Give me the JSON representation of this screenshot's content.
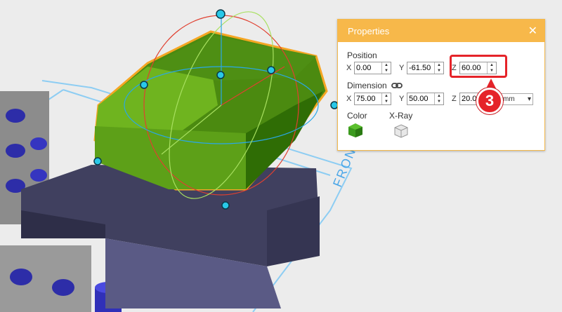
{
  "viewport": {
    "front_label": "FRONT",
    "colors": {
      "selection": "#6aa51a",
      "selection_outline": "#f5a623",
      "base": "#3a3a5e",
      "grid": "#7fc4ef",
      "gizmo_handle": "#29c8e8"
    }
  },
  "properties": {
    "title": "Properties",
    "close_icon": "close-icon",
    "position": {
      "label": "Position",
      "x_label": "X",
      "x": "0.00",
      "y_label": "Y",
      "y": "-61.50",
      "z_label": "Z",
      "z": "60.00"
    },
    "dimension": {
      "label": "Dimension",
      "lock_icon": "link-icon",
      "x_label": "X",
      "x": "75.00",
      "y_label": "Y",
      "y": "50.00",
      "z_label": "Z",
      "z": "20.00",
      "unit": "mm"
    },
    "color_label": "Color",
    "xray_label": "X-Ray",
    "colors": {
      "header": "#f7b84a",
      "swatch": "#3c9a1e"
    }
  },
  "annotation": {
    "step": "3",
    "color": "#e52329"
  }
}
